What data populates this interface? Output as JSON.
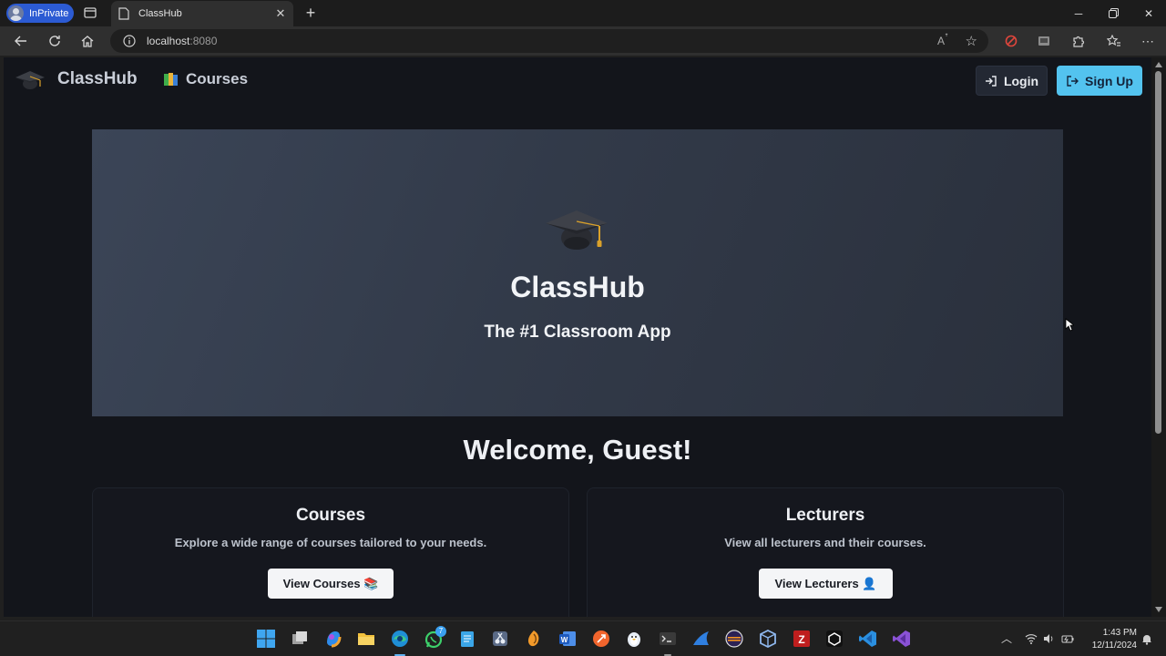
{
  "browser": {
    "profile_label": "InPrivate",
    "tab_title": "ClassHub",
    "url_host": "localhost",
    "url_port": ":8080"
  },
  "app": {
    "brand": "ClassHub",
    "nav_courses": "Courses",
    "login_label": "Login",
    "signup_label": "Sign Up"
  },
  "hero": {
    "title": "ClassHub",
    "subtitle": "The #1 Classroom App"
  },
  "welcome": "Welcome, Guest!",
  "cards": [
    {
      "title": "Courses",
      "description": "Explore a wide range of courses tailored to your needs.",
      "button": "View Courses 📚"
    },
    {
      "title": "Lecturers",
      "description": "View all lecturers and their courses.",
      "button": "View Lecturers 👤"
    }
  ],
  "taskbar": {
    "time": "1:43 PM",
    "date": "12/11/2024",
    "whatsapp_badge": "7"
  },
  "colors": {
    "accent": "#53c3ef",
    "page_bg": "#13151b",
    "hero_bg": "#343c4b"
  }
}
